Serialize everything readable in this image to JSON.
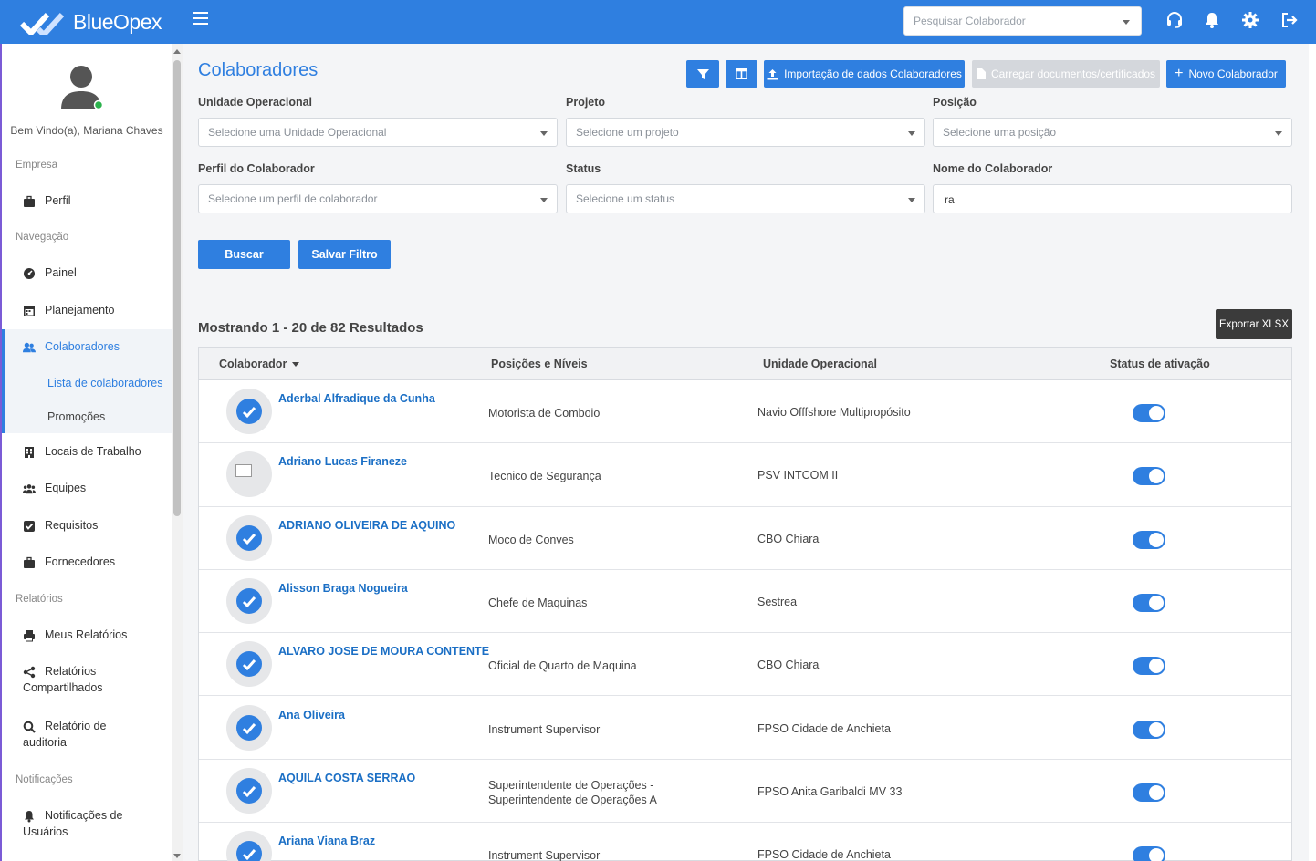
{
  "app": {
    "brand": "BlueOpex",
    "brand_color": "#2f7fe0"
  },
  "topbar": {
    "search_placeholder": "Pesquisar Colaborador",
    "icons": [
      "headset-icon",
      "bell-icon",
      "gear-icon",
      "logout-icon"
    ]
  },
  "sidebar": {
    "welcome": "Bem Vindo(a), Mariana Chaves",
    "sections": {
      "empresa": "Empresa",
      "navegacao": "Navegação",
      "relatorios": "Relatórios",
      "notificacoes": "Notificações"
    },
    "items": {
      "perfil": "Perfil",
      "painel": "Painel",
      "planejamento": "Planejamento",
      "colaboradores": "Colaboradores",
      "lista": "Lista de colaboradores",
      "promocoes": "Promoções",
      "locais": "Locais de Trabalho",
      "equipes": "Equipes",
      "requisitos": "Requisitos",
      "fornecedores": "Fornecedores",
      "meus_relatorios": "Meus Relatórios",
      "rel_compart_1": "Relatórios",
      "rel_compart_2": "Compartilhados",
      "rel_aud_1": "Relatório de",
      "rel_aud_2": "auditoria",
      "notif_1": "Notificações de",
      "notif_2": "Usuários"
    }
  },
  "page": {
    "title": "Colaboradores",
    "toolbar": {
      "import_label": "Importação de dados Colaboradores",
      "upload_docs_label": "Carregar documentos/certificados",
      "new_label": "Novo Colaborador"
    },
    "filters": {
      "unidade_label": "Unidade Operacional",
      "unidade_placeholder": "Selecione uma Unidade Operacional",
      "projeto_label": "Projeto",
      "projeto_placeholder": "Selecione um projeto",
      "posicao_label": "Posição",
      "posicao_placeholder": "Selecione uma posição",
      "perfil_label": "Perfil do Colaborador",
      "perfil_placeholder": "Selecione um perfil de colaborador",
      "status_label": "Status",
      "status_placeholder": "Selecione um status",
      "nome_label": "Nome do Colaborador",
      "nome_value": "ra"
    },
    "buscar_label": "Buscar",
    "salvar_label": "Salvar Filtro",
    "results_text": "Mostrando 1 - 20 de 82 Resultados",
    "export_label": "Exportar XLSX",
    "table": {
      "headers": {
        "colaborador": "Colaborador",
        "posicoes": "Posições e Níveis",
        "unidade": "Unidade Operacional",
        "status": "Status de ativação"
      },
      "rows": [
        {
          "name": "Aderbal Alfradique da Cunha",
          "position": "Motorista de Comboio",
          "unit": "Navio Offfshore Multipropósito",
          "active": true
        },
        {
          "name": "Adriano Lucas Firaneze",
          "position": "Tecnico de Segurança",
          "unit": "PSV INTCOM II",
          "active": true
        },
        {
          "name": "ADRIANO OLIVEIRA DE AQUINO",
          "position": "Moco de Conves",
          "unit": "CBO Chiara",
          "active": true
        },
        {
          "name": "Alisson Braga Nogueira",
          "position": "Chefe de Maquinas",
          "unit": "Sestrea",
          "active": true
        },
        {
          "name": "ALVARO JOSE DE MOURA CONTENTE",
          "position": "Oficial de Quarto de Maquina",
          "unit": "CBO Chiara",
          "active": true
        },
        {
          "name": "Ana Oliveira",
          "position": "Instrument Supervisor",
          "unit": "FPSO Cidade de Anchieta",
          "active": true
        },
        {
          "name": "AQUILA COSTA SERRAO",
          "position": "Superintendente de Operações - Superintendente de Operações A",
          "unit": "FPSO Anita Garibaldi MV 33",
          "active": true
        },
        {
          "name": "Ariana Viana Braz",
          "position": "Instrument Supervisor",
          "unit": "FPSO Cidade de Anchieta",
          "active": true
        }
      ]
    }
  }
}
